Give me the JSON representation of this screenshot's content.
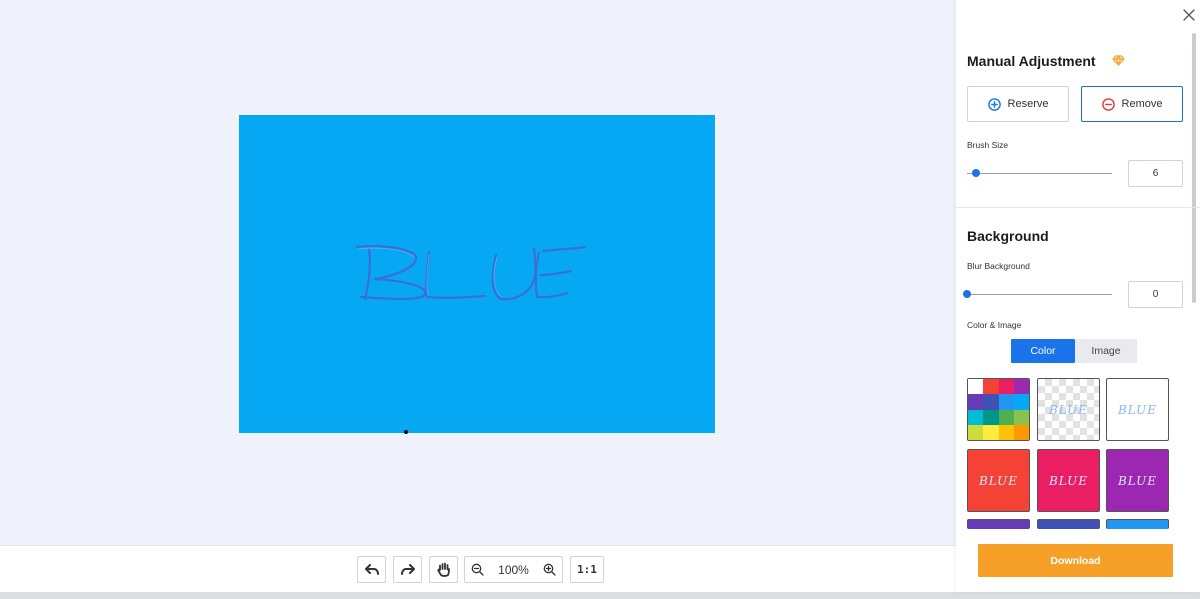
{
  "manual": {
    "title": "Manual Adjustment",
    "reserve_label": "Reserve",
    "remove_label": "Remove",
    "brush_label": "Brush Size",
    "brush_value": "6",
    "brush_level": 0.06
  },
  "background": {
    "title": "Background",
    "blur_label": "Blur Background",
    "blur_value": "0",
    "blur_level": 0,
    "color_image_label": "Color & Image",
    "tabs": {
      "color": "Color",
      "image": "Image"
    },
    "active_tab": "Color",
    "swatches": [
      {
        "name": "palette",
        "color": ""
      },
      {
        "name": "transparent",
        "color": ""
      },
      {
        "name": "white",
        "color": "#ffffff"
      },
      {
        "name": "red",
        "color": "#f44336"
      },
      {
        "name": "pink",
        "color": "#e91e63"
      },
      {
        "name": "purple",
        "color": "#9c27b0"
      },
      {
        "name": "deep-purple",
        "color": "#673ab7"
      },
      {
        "name": "indigo",
        "color": "#3f51b5"
      },
      {
        "name": "light-blue",
        "color": "#2196f3"
      }
    ],
    "palette_colors": [
      "#ffffff",
      "#f44336",
      "#e91e63",
      "#9c27b0",
      "#673ab7",
      "#3f51b5",
      "#2196f3",
      "#03a9f4",
      "#00bcd4",
      "#009688",
      "#4caf50",
      "#8bc34a",
      "#cddc39",
      "#ffeb3b",
      "#ffc107",
      "#ff9800"
    ]
  },
  "canvas": {
    "image_text": "BLUE",
    "background_color": "#06a8f4"
  },
  "toolbar": {
    "zoom": "100%",
    "one_to_one_label": "1:1"
  },
  "download": {
    "label": "Download"
  },
  "colors": {
    "accent": "#1a73e8",
    "download": "#f7a027",
    "premium": "#f7a027"
  }
}
